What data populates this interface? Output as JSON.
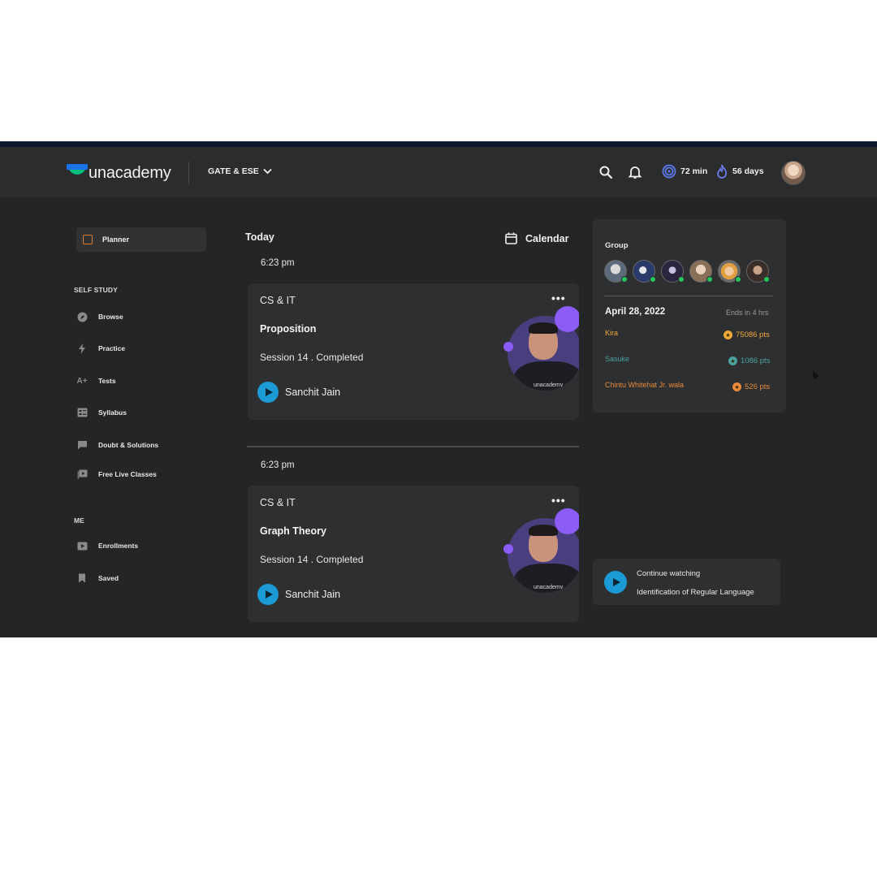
{
  "header": {
    "logo_text": "unacademy",
    "goal_label": "GATE & ESE",
    "watch_time": "72 min",
    "streak": "56 days"
  },
  "sidebar": {
    "planner_label": "Planner",
    "self_study_heading": "SELF STUDY",
    "self_study_items": [
      {
        "label": "Browse",
        "icon": "compass-icon"
      },
      {
        "label": "Practice",
        "icon": "bolt-icon"
      },
      {
        "label": "Tests",
        "icon": "tests-icon"
      },
      {
        "label": "Syllabus",
        "icon": "syllabus-icon"
      },
      {
        "label": "Doubt & Solutions",
        "icon": "chat-icon"
      },
      {
        "label": "Free Live Classes",
        "icon": "live-classes-icon"
      }
    ],
    "me_heading": "ME",
    "me_items": [
      {
        "label": "Enrollments",
        "icon": "play-box-icon"
      },
      {
        "label": "Saved",
        "icon": "bookmark-icon"
      }
    ]
  },
  "main": {
    "today_label": "Today",
    "calendar_label": "Calendar",
    "sessions": [
      {
        "time": "6:23 pm",
        "subject": "CS & IT",
        "more": "•••",
        "title": "Proposition",
        "status": "Session 14 . Completed",
        "teacher": "Sanchit Jain",
        "photo_logo": "unacademy"
      },
      {
        "time": "6:23 pm",
        "subject": "CS & IT",
        "more": "•••",
        "title": "Graph Theory",
        "status": "Session 14 . Completed",
        "teacher": "Sanchit Jain",
        "photo_logo": "unacademy"
      }
    ]
  },
  "group": {
    "title": "Group",
    "date": "April 28, 2022",
    "ends": "Ends in 4 hrs",
    "leaderboard": [
      {
        "name": "Kira",
        "points": "75086 pts",
        "color": "#f0a93b"
      },
      {
        "name": "Sasuke",
        "points": "1086 pts",
        "color": "#4aa3a0"
      },
      {
        "name": "Chintu Whitehat Jr. wala",
        "points": "526 pts",
        "color": "#e88a3a"
      }
    ]
  },
  "continue_watching": {
    "label": "Continue watching",
    "title": "Identification of Regular Language"
  },
  "colors": {
    "brand_green": "#08bd80",
    "brand_blue": "#1a73e8",
    "play_blue": "#1b9ad6",
    "accent_purple": "#8b5cf6",
    "online_green": "#22c55e"
  }
}
